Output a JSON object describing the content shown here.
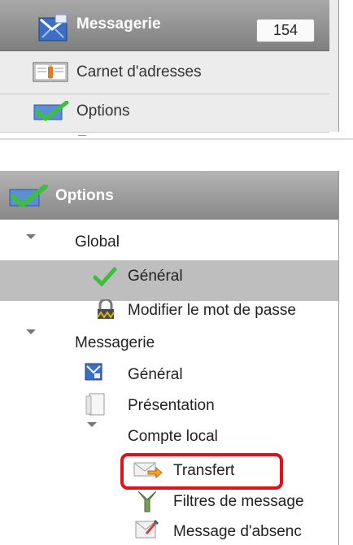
{
  "nav": {
    "messagerie_label": "Messagerie",
    "messagerie_count": "154",
    "carnet_label": "Carnet d'adresses",
    "options_label": "Options"
  },
  "options_panel": {
    "header": "Options",
    "tree": {
      "global": "Global",
      "global_general": "Général",
      "modifier_mdp": "Modifier le mot de passe",
      "messagerie": "Messagerie",
      "msg_general": "Général",
      "presentation": "Présentation",
      "compte_local": "Compte local",
      "transfert": "Transfert",
      "filtres": "Filtres de message",
      "absence": "Message d'absenc"
    }
  },
  "colors": {
    "highlight": "#e2101a",
    "selected_row": "#bebebe"
  }
}
